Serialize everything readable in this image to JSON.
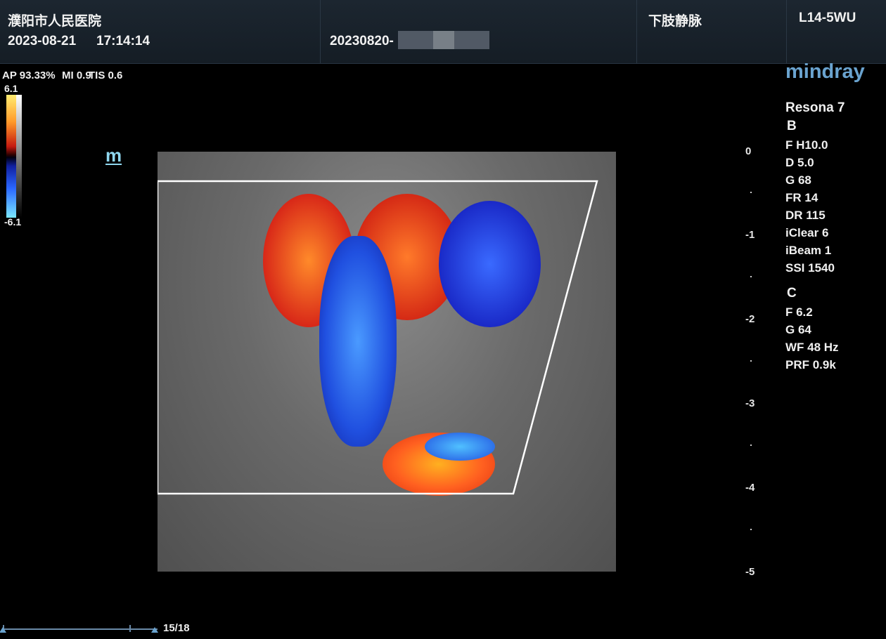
{
  "header": {
    "hospital": "濮阳市人民医院",
    "date": "2023-08-21",
    "time": "17:14:14",
    "patient_id": "20230820-",
    "exam": "下肢静脉",
    "probe": "L14-5WU"
  },
  "acoustic": {
    "ap": "AP 93.33%",
    "mi": "MI 0.9",
    "tis": "TIS 0.6"
  },
  "colorbar": {
    "max": "6.1",
    "min": "-6.1"
  },
  "mode_mark": "m",
  "logo": "mindray",
  "device": "Resona 7",
  "b_mode": {
    "header": "B",
    "params": [
      "F H10.0",
      "D 5.0",
      "G 68",
      "FR 14",
      "DR 115",
      "iClear 6",
      "iBeam 1",
      "SSI 1540"
    ]
  },
  "c_mode": {
    "header": "C",
    "params": [
      "F 6.2",
      "G 64",
      "WF 48 Hz",
      "PRF 0.9k"
    ]
  },
  "depth_scale": [
    "0",
    "-1",
    "-2",
    "-3",
    "-4",
    "-5"
  ],
  "cine": {
    "frame": "15/18"
  }
}
